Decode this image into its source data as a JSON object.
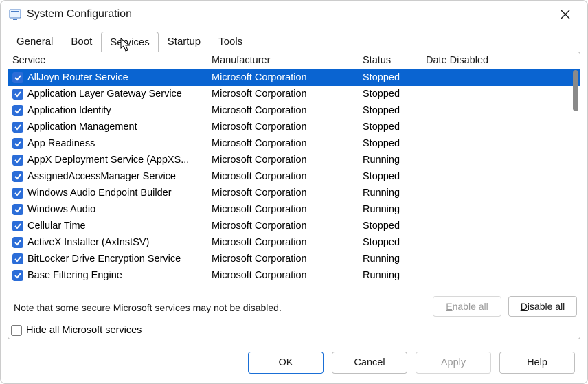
{
  "window": {
    "title": "System Configuration"
  },
  "tabs": [
    {
      "label": "General",
      "active": false
    },
    {
      "label": "Boot",
      "active": false
    },
    {
      "label": "Services",
      "active": true
    },
    {
      "label": "Startup",
      "active": false
    },
    {
      "label": "Tools",
      "active": false
    }
  ],
  "columns": {
    "service": "Service",
    "manufacturer": "Manufacturer",
    "status": "Status",
    "date_disabled": "Date Disabled"
  },
  "rows": [
    {
      "checked": true,
      "selected": true,
      "service": "AllJoyn Router Service",
      "manufacturer": "Microsoft Corporation",
      "status": "Stopped",
      "date_disabled": ""
    },
    {
      "checked": true,
      "selected": false,
      "service": "Application Layer Gateway Service",
      "manufacturer": "Microsoft Corporation",
      "status": "Stopped",
      "date_disabled": ""
    },
    {
      "checked": true,
      "selected": false,
      "service": "Application Identity",
      "manufacturer": "Microsoft Corporation",
      "status": "Stopped",
      "date_disabled": ""
    },
    {
      "checked": true,
      "selected": false,
      "service": "Application Management",
      "manufacturer": "Microsoft Corporation",
      "status": "Stopped",
      "date_disabled": ""
    },
    {
      "checked": true,
      "selected": false,
      "service": "App Readiness",
      "manufacturer": "Microsoft Corporation",
      "status": "Stopped",
      "date_disabled": ""
    },
    {
      "checked": true,
      "selected": false,
      "service": "AppX Deployment Service (AppXS...",
      "manufacturer": "Microsoft Corporation",
      "status": "Running",
      "date_disabled": ""
    },
    {
      "checked": true,
      "selected": false,
      "service": "AssignedAccessManager Service",
      "manufacturer": "Microsoft Corporation",
      "status": "Stopped",
      "date_disabled": ""
    },
    {
      "checked": true,
      "selected": false,
      "service": "Windows Audio Endpoint Builder",
      "manufacturer": "Microsoft Corporation",
      "status": "Running",
      "date_disabled": ""
    },
    {
      "checked": true,
      "selected": false,
      "service": "Windows Audio",
      "manufacturer": "Microsoft Corporation",
      "status": "Running",
      "date_disabled": ""
    },
    {
      "checked": true,
      "selected": false,
      "service": "Cellular Time",
      "manufacturer": "Microsoft Corporation",
      "status": "Stopped",
      "date_disabled": ""
    },
    {
      "checked": true,
      "selected": false,
      "service": "ActiveX Installer (AxInstSV)",
      "manufacturer": "Microsoft Corporation",
      "status": "Stopped",
      "date_disabled": ""
    },
    {
      "checked": true,
      "selected": false,
      "service": "BitLocker Drive Encryption Service",
      "manufacturer": "Microsoft Corporation",
      "status": "Running",
      "date_disabled": ""
    },
    {
      "checked": true,
      "selected": false,
      "service": "Base Filtering Engine",
      "manufacturer": "Microsoft Corporation",
      "status": "Running",
      "date_disabled": ""
    }
  ],
  "note": "Note that some secure Microsoft services may not be disabled.",
  "buttons": {
    "enable_all": "Enable all",
    "disable_all": "Disable all",
    "ok": "OK",
    "cancel": "Cancel",
    "apply": "Apply",
    "help": "Help"
  },
  "hide_ms": {
    "label": "Hide all Microsoft services",
    "checked": false
  }
}
